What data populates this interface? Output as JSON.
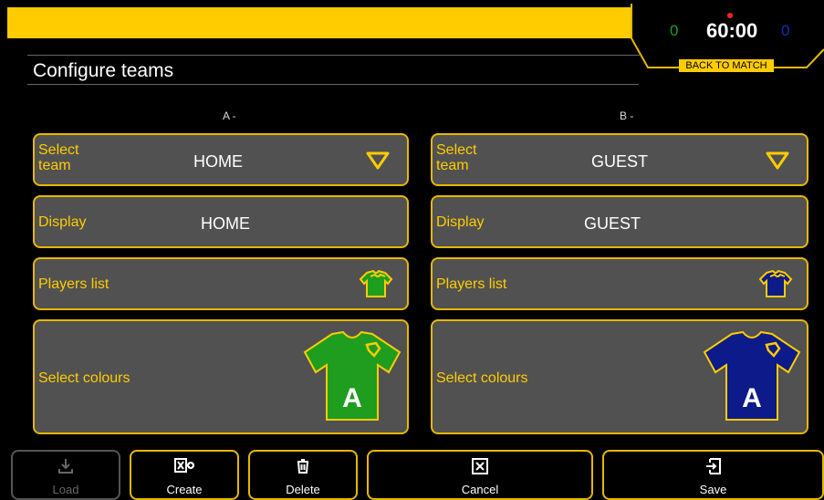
{
  "header": {
    "title": "Configure teams",
    "score_a": "0",
    "score_b": "0",
    "clock": "60:00",
    "back_label": "BACK TO MATCH"
  },
  "team_a": {
    "heading": "A -",
    "select_label": "Select\nteam",
    "selected_team": "HOME",
    "display_label": "Display",
    "display_value": "HOME",
    "players_label": "Players list",
    "colours_label": "Select colours",
    "shirt_letter": "A",
    "shirt_color": "#1f9d1f"
  },
  "team_b": {
    "heading": "B -",
    "select_label": "Select\nteam",
    "selected_team": "GUEST",
    "display_label": "Display",
    "display_value": "GUEST",
    "players_label": "Players list",
    "colours_label": "Select colours",
    "shirt_letter": "A",
    "shirt_color": "#0d1a8a"
  },
  "footer": {
    "load": "Load",
    "create": "Create",
    "delete": "Delete",
    "cancel": "Cancel",
    "save": "Save"
  },
  "colors": {
    "accent": "#ffcc00",
    "card_bg": "#515151"
  }
}
